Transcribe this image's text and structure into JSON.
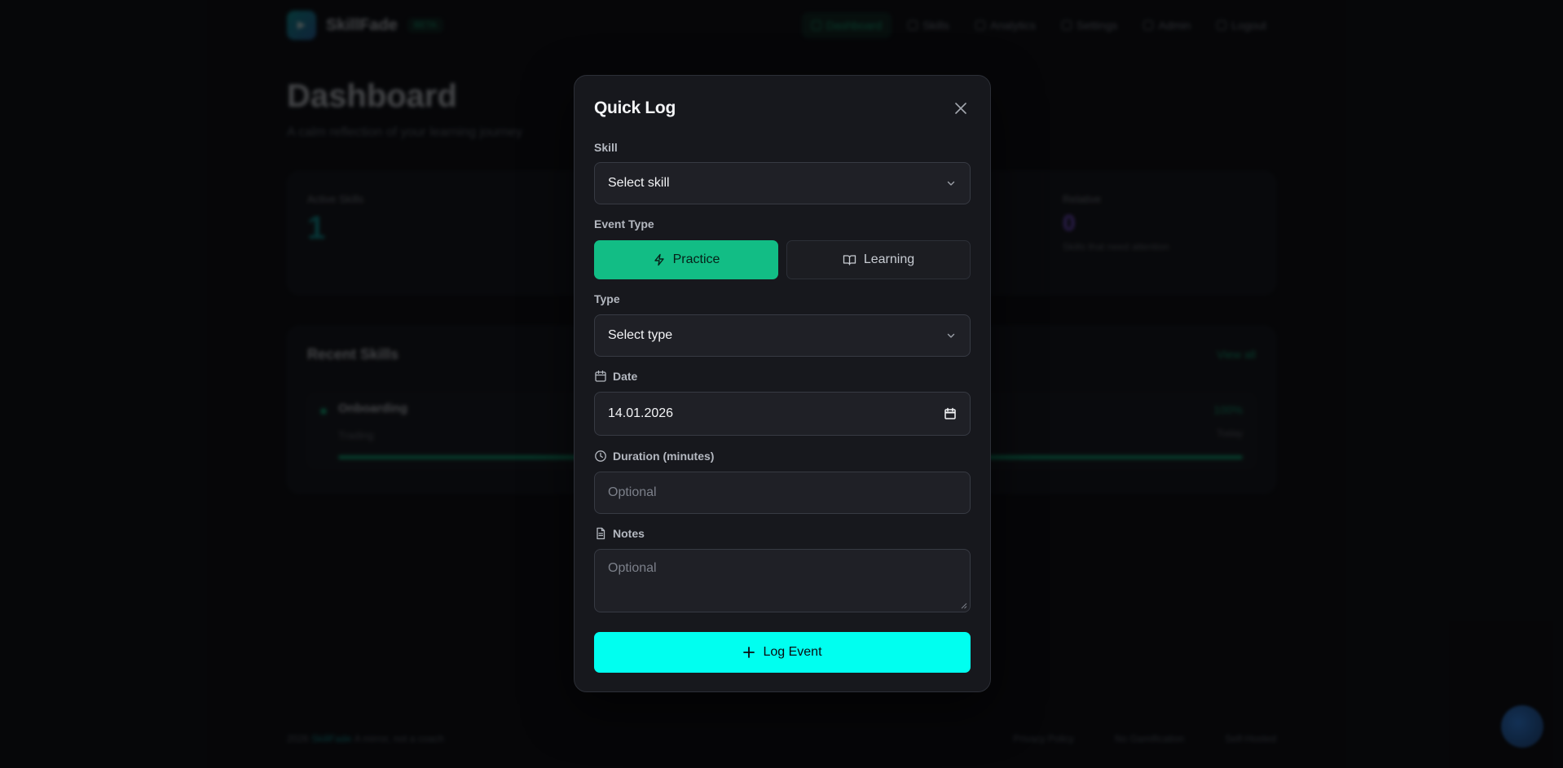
{
  "app": {
    "name": "SkillFade",
    "badge": "BETA"
  },
  "nav": {
    "items": [
      "Dashboard",
      "Skills",
      "Analytics",
      "Settings",
      "Admin",
      "Logout"
    ]
  },
  "dashboard": {
    "title": "Dashboard",
    "subtitle": "A calm reflection of your learning journey",
    "cards": [
      {
        "label": "Active Skills",
        "value": "1"
      },
      {
        "label": "Relative",
        "value": "0",
        "note": "Skills that need attention"
      }
    ],
    "recent": {
      "title": "Recent Skills",
      "view_all": "View all",
      "skill": {
        "name": "Onboarding",
        "meta": "Trading",
        "percent": "100%",
        "ago": "Today"
      }
    }
  },
  "footer": {
    "copyright": "2026",
    "brand": "SkillFade",
    "tagline": "A mirror, not a coach",
    "links": [
      "Privacy Policy",
      "No Gamification",
      "Self-Hosted"
    ]
  },
  "modal": {
    "title": "Quick Log",
    "skill_label": "Skill",
    "skill_value": "Select skill",
    "event_type_label": "Event Type",
    "practice_label": "Practice",
    "learning_label": "Learning",
    "type_label": "Type",
    "type_value": "Select type",
    "date_label": "Date",
    "date_value": "14.01.2026",
    "duration_label": "Duration (minutes)",
    "duration_placeholder": "Optional",
    "notes_label": "Notes",
    "notes_placeholder": "Optional",
    "submit_label": "Log Event"
  },
  "colors": {
    "accent_green": "#12bd85",
    "accent_cyan": "#00fff0",
    "modal_bg": "#17181d",
    "page_bg": "#0b0c10"
  },
  "icons": {
    "close": "close-icon",
    "chevron": "chevron-down-icon",
    "practice": "zap-icon",
    "learning": "book-open-icon",
    "date": "calendar-icon",
    "duration": "clock-icon",
    "notes": "file-text-icon",
    "submit": "plus-icon"
  }
}
